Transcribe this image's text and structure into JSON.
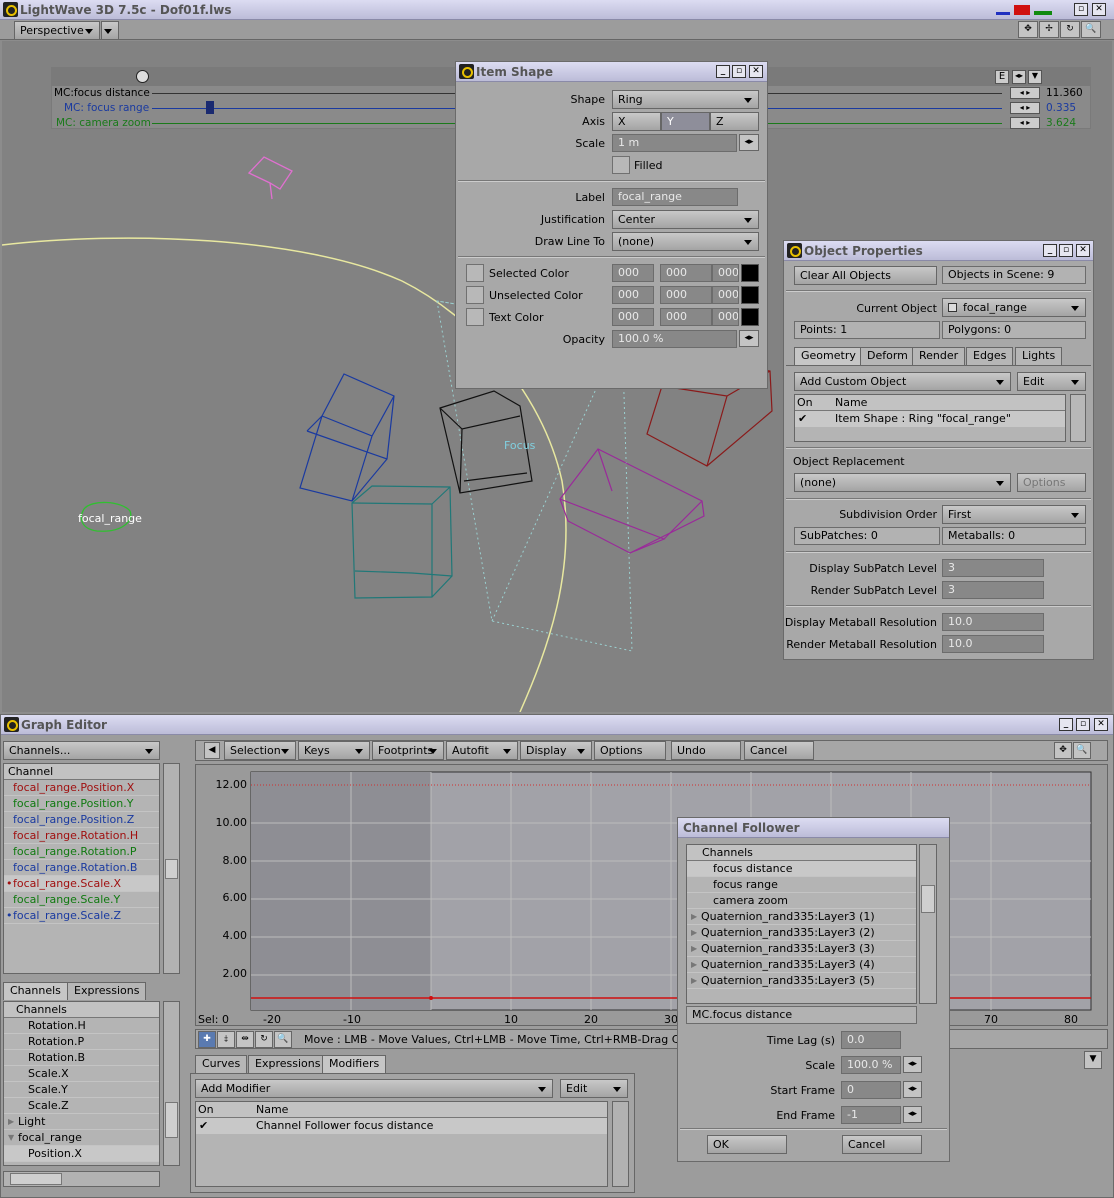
{
  "app": {
    "title": "LightWave 3D 7.5c - Dof01f.lws"
  },
  "viewport": {
    "view_mode": "Perspective",
    "channels": [
      {
        "name": "MC:focus distance",
        "value": "11.360",
        "color": "#000000"
      },
      {
        "name": "MC: focus range",
        "value": "0.335",
        "color": "#1a3aa0"
      },
      {
        "name": "MC: camera zoom",
        "value": "3.624",
        "color": "#1a7a1a"
      }
    ],
    "e_label": "E",
    "focus_label": "Focus",
    "object_label": "focal_range"
  },
  "item_shape": {
    "title": "Item Shape",
    "shape_label": "Shape",
    "shape_value": "Ring",
    "axis_label": "Axis",
    "axis_options": [
      "X",
      "Y",
      "Z"
    ],
    "axis_selected": "Y",
    "scale_label": "Scale",
    "scale_value": "1 m",
    "filled_label": "Filled",
    "label_label": "Label",
    "label_value": "focal_range",
    "justification_label": "Justification",
    "justification_value": "Center",
    "drawline_label": "Draw Line To",
    "drawline_value": "(none)",
    "selected_color_label": "Selected Color",
    "unselected_color_label": "Unselected Color",
    "text_color_label": "Text Color",
    "rgb_value": "000",
    "opacity_label": "Opacity",
    "opacity_value": "100.0 %"
  },
  "object_properties": {
    "title": "Object Properties",
    "clear_all": "Clear All Objects",
    "objects_in_scene": "Objects in Scene: 9",
    "current_object_label": "Current Object",
    "current_object_value": "focal_range",
    "points": "Points: 1",
    "polygons": "Polygons: 0",
    "tabs": [
      "Geometry",
      "Deform",
      "Render",
      "Edges",
      "Lights"
    ],
    "add_custom": "Add Custom Object",
    "edit": "Edit",
    "col_on": "On",
    "col_name": "Name",
    "custom_row": "Item Shape : Ring \"focal_range\"",
    "replacement_label": "Object Replacement",
    "replacement_value": "(none)",
    "options": "Options",
    "subdiv_order_label": "Subdivision Order",
    "subdiv_order_value": "First",
    "subpatches": "SubPatches: 0",
    "metaballs": "Metaballs: 0",
    "display_subpatch_label": "Display SubPatch Level",
    "display_subpatch_value": "3",
    "render_subpatch_label": "Render SubPatch Level",
    "render_subpatch_value": "3",
    "display_meta_label": "Display Metaball Resolution",
    "display_meta_value": "10.0",
    "render_meta_label": "Render Metaball Resolution",
    "render_meta_value": "10.0"
  },
  "graph_editor": {
    "title": "Graph Editor",
    "channels_dropdown": "Channels...",
    "channel_header": "Channel",
    "channels": [
      {
        "name": "focal_range.Position.X",
        "color": "#a01010",
        "marker": ""
      },
      {
        "name": "focal_range.Position.Y",
        "color": "#107a10",
        "marker": ""
      },
      {
        "name": "focal_range.Position.Z",
        "color": "#1a3aa0",
        "marker": ""
      },
      {
        "name": "focal_range.Rotation.H",
        "color": "#a01010",
        "marker": ""
      },
      {
        "name": "focal_range.Rotation.P",
        "color": "#107a10",
        "marker": ""
      },
      {
        "name": "focal_range.Rotation.B",
        "color": "#1a3aa0",
        "marker": ""
      },
      {
        "name": "focal_range.Scale.X",
        "color": "#a01010",
        "marker": "•"
      },
      {
        "name": "focal_range.Scale.Y",
        "color": "#107a10",
        "marker": ""
      },
      {
        "name": "focal_range.Scale.Z",
        "color": "#1a3aa0",
        "marker": "•"
      }
    ],
    "left_tabs": [
      "Channels",
      "Expressions"
    ],
    "tree_header": "Channels",
    "tree": [
      {
        "name": "Rotation.H",
        "indent": 2
      },
      {
        "name": "Rotation.P",
        "indent": 2
      },
      {
        "name": "Rotation.B",
        "indent": 2
      },
      {
        "name": "Scale.X",
        "indent": 2
      },
      {
        "name": "Scale.Y",
        "indent": 2
      },
      {
        "name": "Scale.Z",
        "indent": 2
      },
      {
        "name": "Light",
        "indent": 1
      },
      {
        "name": "focal_range",
        "indent": 1
      },
      {
        "name": "Position.X",
        "indent": 2
      }
    ],
    "toolbar": [
      "Selection",
      "Keys",
      "Footprints",
      "Autofit",
      "Display",
      "Options",
      "Undo",
      "Cancel"
    ],
    "y_ticks": [
      "12.00",
      "10.00",
      "8.00",
      "6.00",
      "4.00",
      "2.00"
    ],
    "x_ticks": [
      "-20",
      "-10",
      "10",
      "20",
      "30",
      "70",
      "80"
    ],
    "sel_label": "Sel: 0",
    "status_text": "Move   :  LMB - Move Values, Ctrl+LMB - Move Time, Ctrl+RMB-Drag Copy, Alt-",
    "bottom_tabs": [
      "Curves",
      "Expressions",
      "Modifiers"
    ],
    "add_modifier": "Add Modifier",
    "edit": "Edit",
    "col_on": "On",
    "col_name": "Name",
    "modifier_row": "Channel Follower focus distance"
  },
  "channel_follower": {
    "title": "Channel Follower",
    "header": "Channels",
    "items": [
      {
        "name": "focus distance",
        "indent": 0
      },
      {
        "name": "focus range",
        "indent": 0
      },
      {
        "name": "camera zoom",
        "indent": 0
      },
      {
        "name": "Quaternion_rand335:Layer3 (1)",
        "indent": 1
      },
      {
        "name": "Quaternion_rand335:Layer3 (2)",
        "indent": 1
      },
      {
        "name": "Quaternion_rand335:Layer3 (3)",
        "indent": 1
      },
      {
        "name": "Quaternion_rand335:Layer3 (4)",
        "indent": 1
      },
      {
        "name": "Quaternion_rand335:Layer3 (5)",
        "indent": 1
      }
    ],
    "selected_channel": "MC.focus distance",
    "time_lag_label": "Time Lag (s)",
    "time_lag_value": "0.0",
    "scale_label": "Scale",
    "scale_value": "100.0 %",
    "start_frame_label": "Start Frame",
    "start_frame_value": "0",
    "end_frame_label": "End Frame",
    "end_frame_value": "-1",
    "ok": "OK",
    "cancel": "Cancel"
  }
}
